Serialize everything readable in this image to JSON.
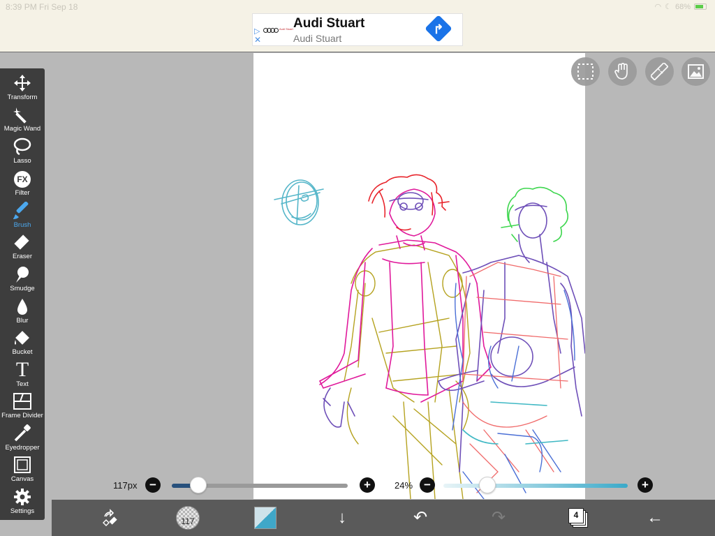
{
  "status": {
    "time": "8:39 PM   Fri Sep 18",
    "battery": "68%"
  },
  "ad": {
    "title": "Audi Stuart",
    "subtitle": "Audi Stuart",
    "brand_sub": "Audi Stuart",
    "close_glyph": "✕",
    "adchoice_glyph": "▷"
  },
  "toolbar": {
    "tools": [
      {
        "label": "Transform",
        "icon": "move-icon",
        "active": false
      },
      {
        "label": "Magic Wand",
        "icon": "magic-wand-icon",
        "active": false
      },
      {
        "label": "Lasso",
        "icon": "lasso-icon",
        "active": false
      },
      {
        "label": "Filter",
        "icon": "fx-icon",
        "active": false
      },
      {
        "label": "Brush",
        "icon": "brush-icon",
        "active": true
      },
      {
        "label": "Eraser",
        "icon": "eraser-icon",
        "active": false
      },
      {
        "label": "Smudge",
        "icon": "smudge-icon",
        "active": false
      },
      {
        "label": "Blur",
        "icon": "drop-icon",
        "active": false
      },
      {
        "label": "Bucket",
        "icon": "bucket-icon",
        "active": false
      },
      {
        "label": "Text",
        "icon": "text-icon",
        "active": false
      },
      {
        "label": "Frame Divider",
        "icon": "frame-divider-icon",
        "active": false
      },
      {
        "label": "Eyedropper",
        "icon": "eyedropper-icon",
        "active": false
      },
      {
        "label": "Canvas",
        "icon": "canvas-icon",
        "active": false
      },
      {
        "label": "Settings",
        "icon": "gear-icon",
        "active": false
      }
    ],
    "glyphs": {
      "fx": "FX",
      "text": "T"
    }
  },
  "quick_buttons": [
    "selection-icon",
    "hand-icon",
    "ruler-icon",
    "image-icon"
  ],
  "sliders": {
    "brush_size": {
      "value": "117px",
      "fill": 0.15,
      "minus": "−",
      "plus": "+"
    },
    "opacity": {
      "value": "24%",
      "fill": 0.24,
      "minus": "−",
      "plus": "+"
    }
  },
  "bottom_bar": {
    "brush_size_label": "117",
    "layer_count": "4",
    "icons": [
      "swap-tool-icon",
      "brush-preview",
      "color-swatch",
      "download-arrow-icon",
      "undo-icon",
      "redo-icon",
      "layers-icon",
      "back-arrow-icon"
    ],
    "glyphs": {
      "download": "↓",
      "undo": "↶",
      "redo": "↷",
      "back": "←"
    }
  },
  "colors": {
    "toolbar_bg": "#3d3d3d",
    "active_tool": "#4ca8ee",
    "bottom_bar_bg": "#5a5a5a",
    "sketch_red": "#e8242b",
    "sketch_magenta": "#e0199b",
    "sketch_olive": "#b5a21f",
    "sketch_purple": "#6e4fb8",
    "sketch_green": "#3dd64e",
    "sketch_cyan": "#55b6c9"
  }
}
